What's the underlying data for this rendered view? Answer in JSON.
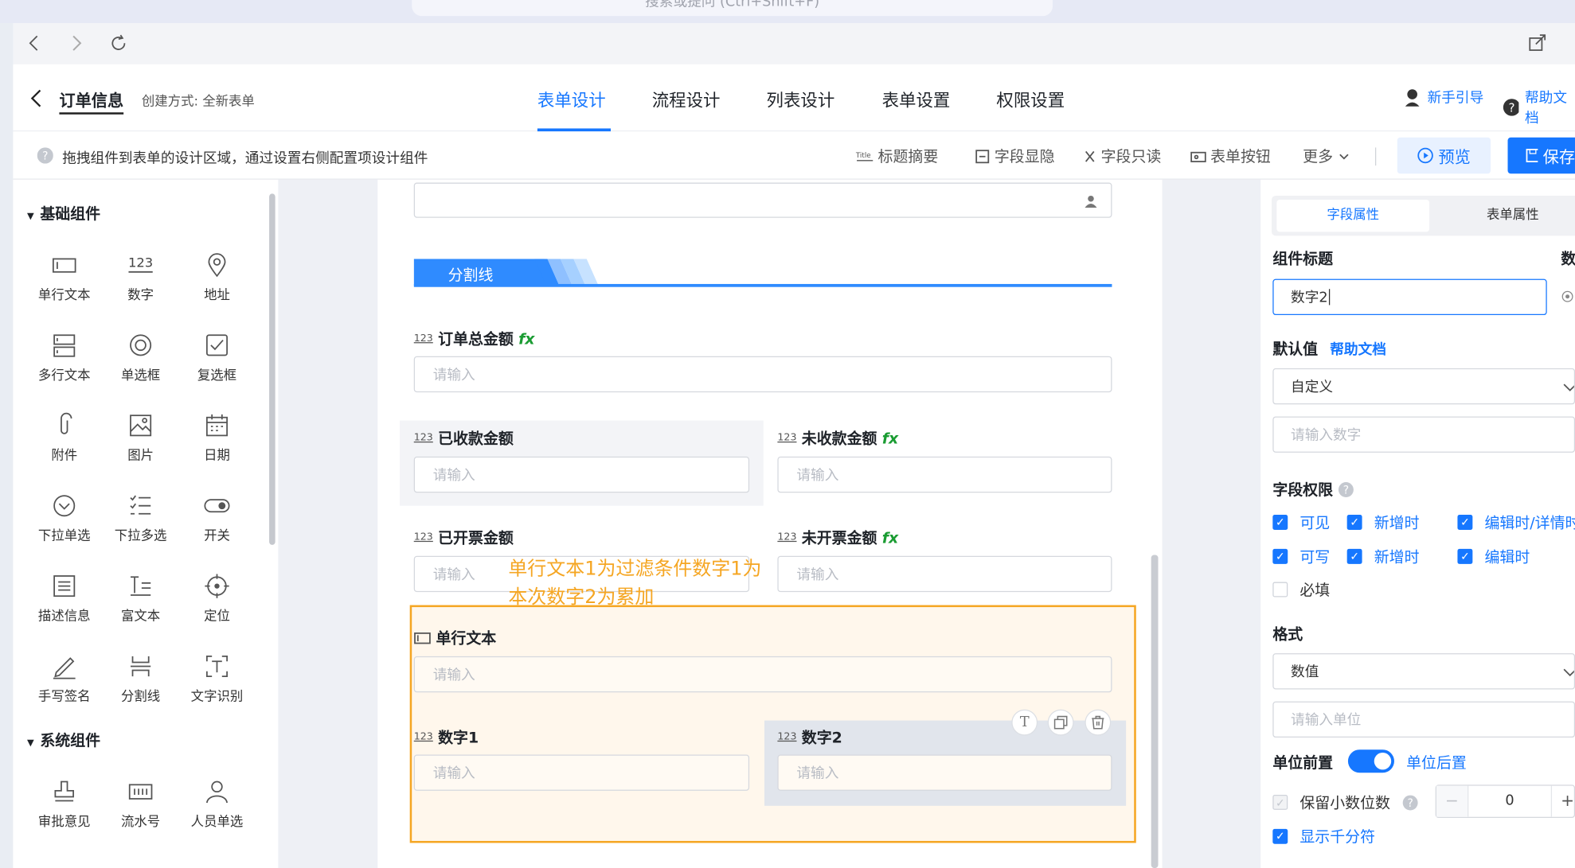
{
  "window": {
    "search_placeholder": "搜索或提问 (Ctrl+Shift+F)"
  },
  "header": {
    "back_title": "订单信息",
    "create_mode": "创建方式: 全新表单",
    "tabs": [
      {
        "label": "表单设计"
      },
      {
        "label": "流程设计"
      },
      {
        "label": "列表设计"
      },
      {
        "label": "表单设置"
      },
      {
        "label": "权限设置"
      }
    ],
    "guide": "新手引导",
    "help": "帮助文档"
  },
  "toolbar": {
    "hint": "拖拽组件到表单的设计区域，通过设置右侧配置项设计组件",
    "title_summary": "标题摘要",
    "field_visibility": "字段显隐",
    "field_readonly": "字段只读",
    "form_buttons": "表单按钮",
    "more": "更多",
    "preview": "预览",
    "save": "保存"
  },
  "left": {
    "basic_group": "基础组件",
    "system_group": "系统组件",
    "basic": [
      {
        "label": "单行文本",
        "icon": "single-line-text-icon"
      },
      {
        "label": "数字",
        "icon": "number-icon"
      },
      {
        "label": "地址",
        "icon": "location-pin-icon"
      },
      {
        "label": "多行文本",
        "icon": "multiline-text-icon"
      },
      {
        "label": "单选框",
        "icon": "radio-icon"
      },
      {
        "label": "复选框",
        "icon": "checkbox-icon"
      },
      {
        "label": "附件",
        "icon": "paperclip-icon"
      },
      {
        "label": "图片",
        "icon": "image-icon"
      },
      {
        "label": "日期",
        "icon": "calendar-icon"
      },
      {
        "label": "下拉单选",
        "icon": "dropdown-icon"
      },
      {
        "label": "下拉多选",
        "icon": "list-icon"
      },
      {
        "label": "开关",
        "icon": "toggle-icon"
      },
      {
        "label": "描述信息",
        "icon": "description-icon"
      },
      {
        "label": "富文本",
        "icon": "rich-text-icon"
      },
      {
        "label": "定位",
        "icon": "crosshair-icon"
      },
      {
        "label": "手写签名",
        "icon": "pen-icon"
      },
      {
        "label": "分割线",
        "icon": "divider-icon"
      },
      {
        "label": "文字识别",
        "icon": "ocr-icon"
      }
    ],
    "system": [
      {
        "label": "审批意见",
        "icon": "stamp-icon"
      },
      {
        "label": "流水号",
        "icon": "serial-number-icon"
      },
      {
        "label": "人员单选",
        "icon": "person-icon"
      }
    ]
  },
  "form": {
    "divider": "分割线",
    "num_tag": "123",
    "fx": "fx",
    "placeholder": "请输入",
    "order_total": "订单总金额",
    "received": "已收款金额",
    "unreceived": "未收款金额",
    "invoiced": "已开票金额",
    "uninvoiced": "未开票金额",
    "annotation_line1": "单行文本1为过滤条件数字1为",
    "annotation_line2": "本次数字2为累加",
    "single_text": "单行文本",
    "num1": "数字1",
    "num2": "数字2"
  },
  "right": {
    "tab_field": "字段属性",
    "tab_form": "表单属性",
    "comp_title": "组件标题",
    "title_extra": "数",
    "title_value": "数字2",
    "default_value": "默认值",
    "help_doc": "帮助文档",
    "default_mode": "自定义",
    "num_placeholder": "请输入数字",
    "perm": "字段权限",
    "visible": "可见",
    "add_time": "新增时",
    "edit_detail": "编辑时/详情时",
    "writable": "可写",
    "edit_time": "编辑时",
    "required": "必填",
    "format": "格式",
    "format_value": "数值",
    "unit_placeholder": "请输入单位",
    "unit_prefix": "单位前置",
    "unit_suffix": "单位后置",
    "decimals": "保留小数位数",
    "decimals_value": "0",
    "thousands": "显示千分符"
  },
  "colors": {
    "accent": "#1677ff",
    "annotation": "#f5a623",
    "fx": "#1a9c32"
  }
}
